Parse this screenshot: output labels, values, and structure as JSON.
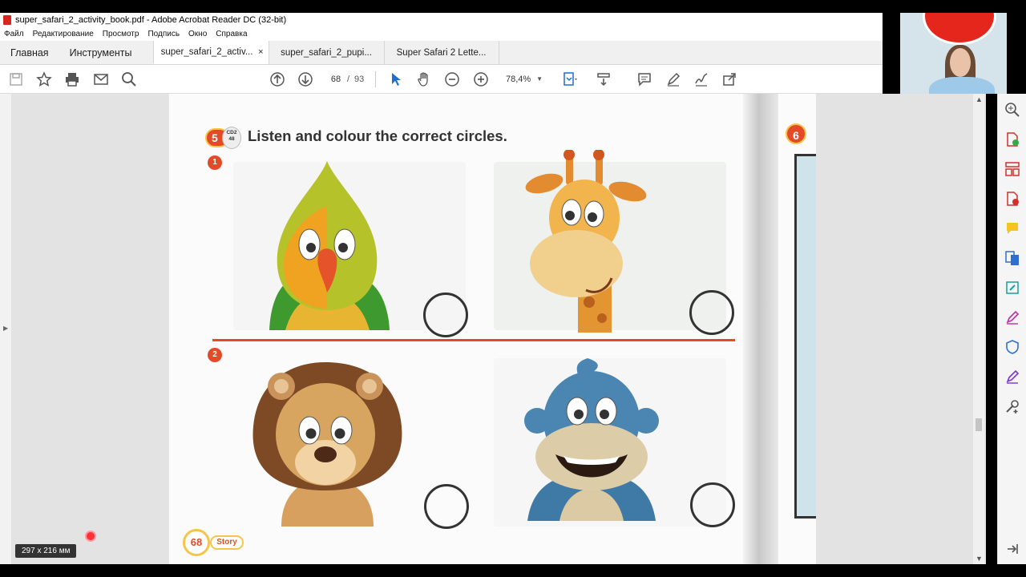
{
  "window": {
    "title": "super_safari_2_activity_book.pdf - Adobe Acrobat Reader DC (32-bit)"
  },
  "menu": [
    "Файл",
    "Редактирование",
    "Просмотр",
    "Подпись",
    "Окно",
    "Справка"
  ],
  "nav_tabs": [
    "Главная",
    "Инструменты"
  ],
  "doc_tabs": [
    {
      "label": "super_safari_2_activ...",
      "active": true,
      "close": "×"
    },
    {
      "label": "super_safari_2_pupi...",
      "active": false
    },
    {
      "label": "Super Safari 2 Lette...",
      "active": false
    }
  ],
  "toolbar": {
    "page_current": "68",
    "page_separator": "/",
    "page_total": "93",
    "zoom": "78,4%",
    "icons": [
      "save-icon",
      "bookmark-star-icon",
      "print-icon",
      "email-icon",
      "search-icon",
      "prev-page-icon",
      "next-page-icon",
      "select-cursor-icon",
      "hand-icon",
      "zoom-out-icon",
      "zoom-in-icon",
      "fit-page-icon",
      "scroll-mode-icon",
      "comment-icon",
      "pen-icon",
      "sign-icon",
      "share-icon"
    ]
  },
  "page": {
    "exercise_number": "5",
    "cd_label": "CD2",
    "cd_track": "48",
    "instruction": "Listen and colour the correct circles.",
    "items": [
      {
        "number": "1",
        "characters": [
          "parrot",
          "giraffe"
        ]
      },
      {
        "number": "2",
        "characters": [
          "lion",
          "monkey"
        ]
      }
    ],
    "page_number": "68",
    "section_label": "Story",
    "next_page_badge": "6"
  },
  "status": {
    "page_size": "297 x 216 мм"
  },
  "tools_panel": [
    "zoom-tool-icon",
    "create-pdf-icon",
    "organize-pages-icon",
    "export-pdf-icon",
    "comment-tool-icon",
    "combine-files-icon",
    "edit-pdf-icon",
    "fill-sign-icon",
    "protect-icon",
    "sign-tool-icon",
    "more-tools-icon",
    "collapse-panel-icon"
  ],
  "colors": {
    "accent_red": "#e24a28",
    "badge_yellow": "#f7c44a"
  }
}
